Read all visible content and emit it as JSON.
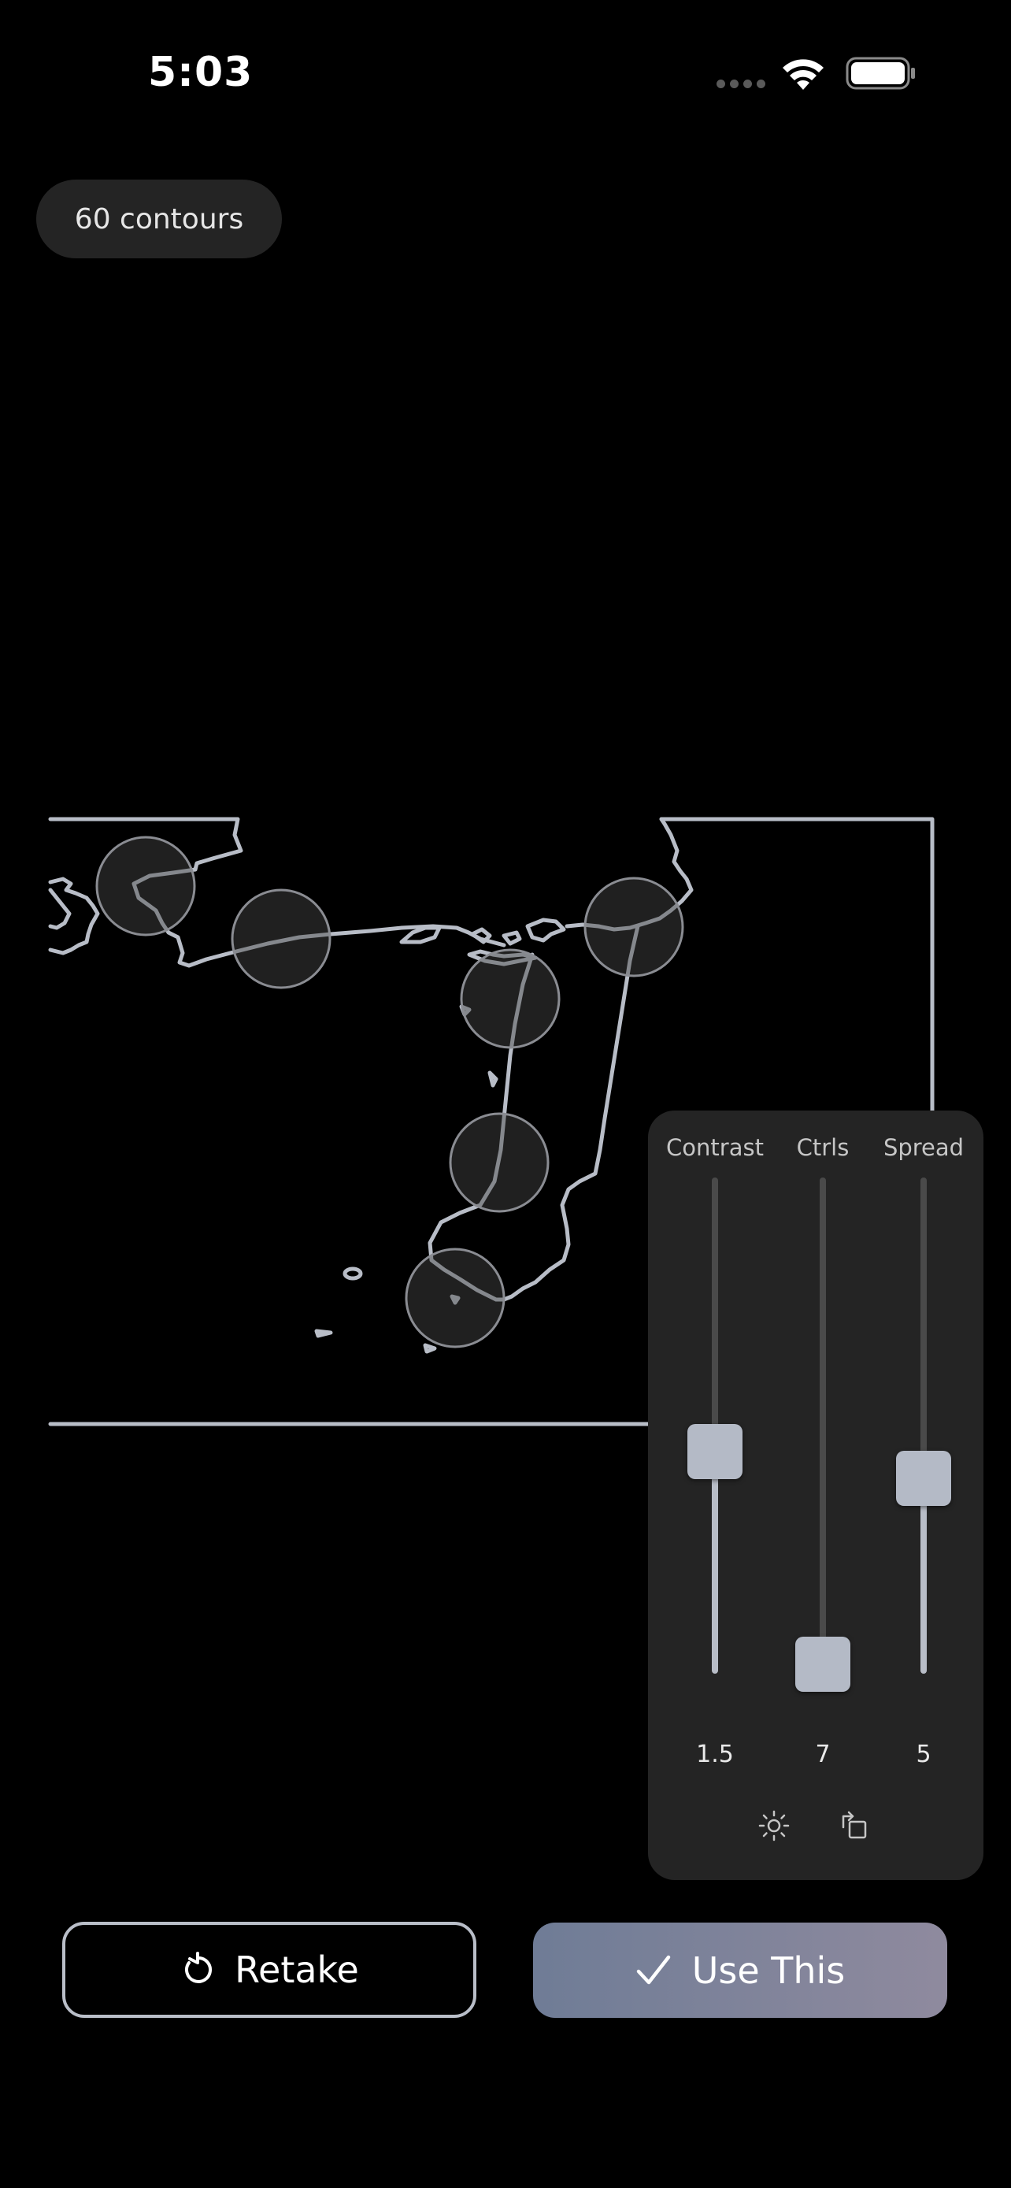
{
  "status_bar": {
    "time": "5:03"
  },
  "contour_count_label": "60 contours",
  "controls": {
    "sliders": [
      {
        "name": "contrast",
        "label": "Contrast",
        "value": "1.5",
        "position_fraction": 0.51
      },
      {
        "name": "ctrls",
        "label": "Ctrls",
        "value": "7",
        "position_fraction": 0.12
      },
      {
        "name": "spread",
        "label": "Spread",
        "value": "5",
        "position_fraction": 0.46
      }
    ],
    "icons": [
      "sun-icon",
      "rotate-icon"
    ]
  },
  "buttons": {
    "retake_label": "Retake",
    "use_label": "Use This"
  },
  "colors": {
    "contour_line": "#b8bdc7",
    "panel_bg": "#242424",
    "use_gradient_start": "#6f7c96",
    "use_gradient_end": "#8f8a9e"
  }
}
